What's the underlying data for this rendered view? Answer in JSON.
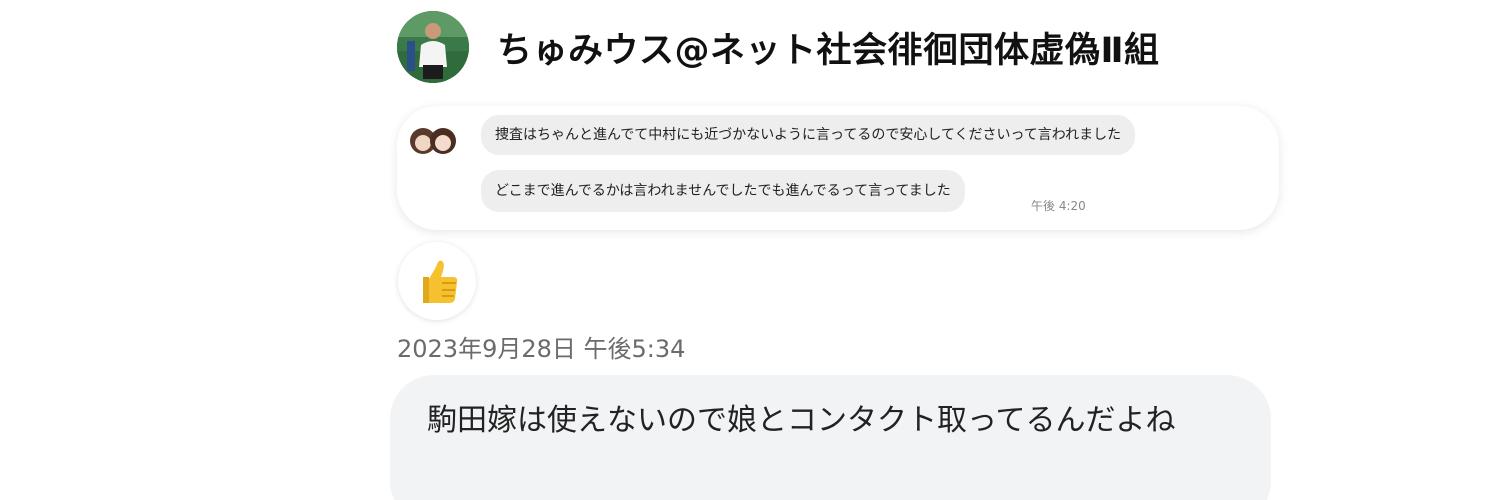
{
  "header": {
    "display_name": "ちゅみウス@ネット社会徘徊団体虚偽Ⅱ組",
    "avatar_icon": "user-avatar-photo"
  },
  "embedded_chat": {
    "avatar_icon": "two-person-avatar",
    "messages": [
      {
        "text": "捜査はちゃんと進んでて中村にも近づかないように言ってるので安心してくださいって言われました"
      },
      {
        "text": "どこまで進んでるかは言われませんでしたでも進んでるって言ってました",
        "time": "午後 4:20"
      }
    ]
  },
  "reaction": {
    "icon": "thumbs-up-icon",
    "color": "#f5c12e"
  },
  "timestamp": "2023年9月28日 午後5:34",
  "message": {
    "text": "駒田嫁は使えないので娘とコンタクト取ってるんだよね"
  },
  "colors": {
    "bubble_bg": "#f2f3f5",
    "text": "#222222",
    "timestamp": "#6b6b6b"
  }
}
